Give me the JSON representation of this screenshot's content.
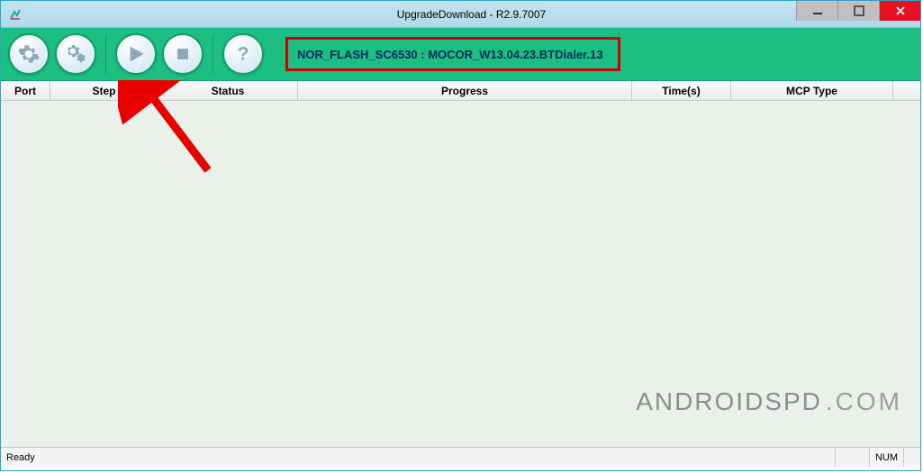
{
  "window": {
    "title": "UpgradeDownload - R2.9.7007"
  },
  "toolbar": {
    "buttons": {
      "settings": "gear-icon",
      "settings2": "double-gear-icon",
      "start": "play-icon",
      "stop": "stop-icon",
      "help": "help-icon"
    },
    "flash_info": "NOR_FLASH_SC6530 : MOCOR_W13.04.23.BTDialer.13"
  },
  "table": {
    "headers": {
      "port": "Port",
      "step": "Step",
      "status": "Status",
      "progress": "Progress",
      "times": "Time(s)",
      "mcp": "MCP Type"
    }
  },
  "statusbar": {
    "status": "Ready",
    "indicator": "NUM"
  },
  "watermark": {
    "part1": "ANDROIDSPD",
    "part2": ".COM"
  }
}
